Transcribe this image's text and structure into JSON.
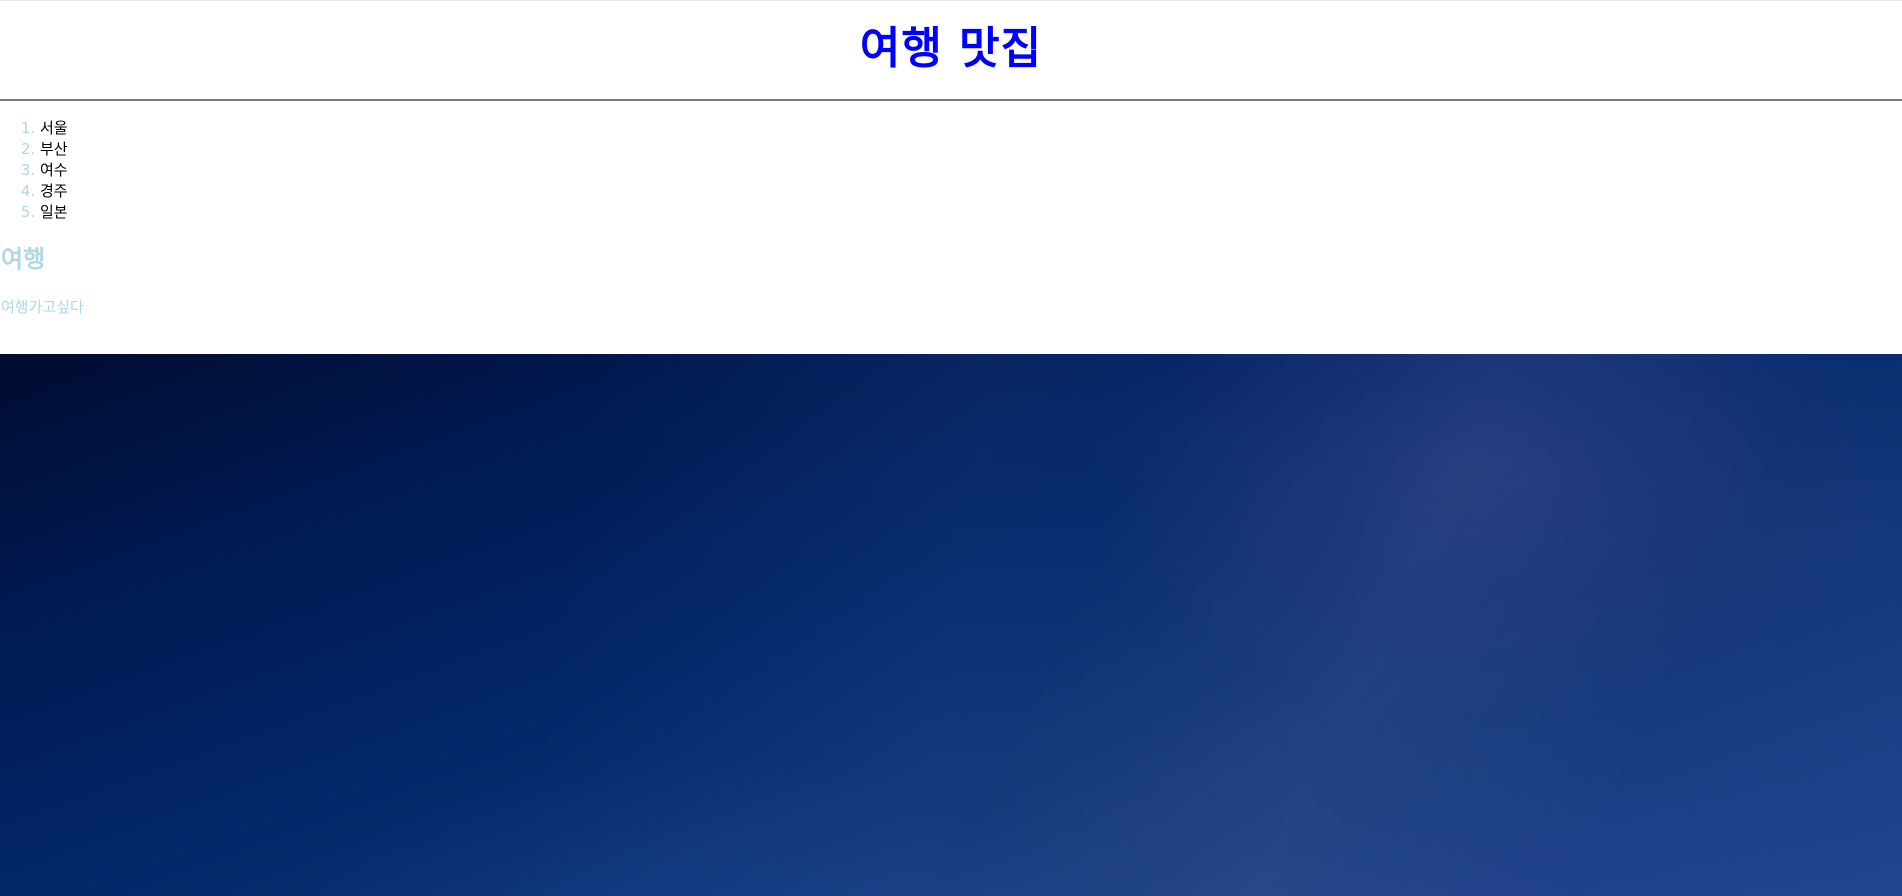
{
  "header": {
    "title": "여행 맛집"
  },
  "cities": {
    "items": [
      {
        "label": "서울"
      },
      {
        "label": "부산"
      },
      {
        "label": "여수"
      },
      {
        "label": "경주"
      },
      {
        "label": "일본"
      }
    ]
  },
  "section": {
    "heading": "여행",
    "text": "여행가고싶다"
  },
  "colors": {
    "title": "#0000ff",
    "heading": "#add8e6",
    "text": "#add8e6",
    "list_marker": "#add8e6",
    "list_item": "#000000",
    "banner_top": "#000c30",
    "banner_bottom": "#23458f"
  },
  "banner": {
    "description_icon": "night-sky-image"
  }
}
